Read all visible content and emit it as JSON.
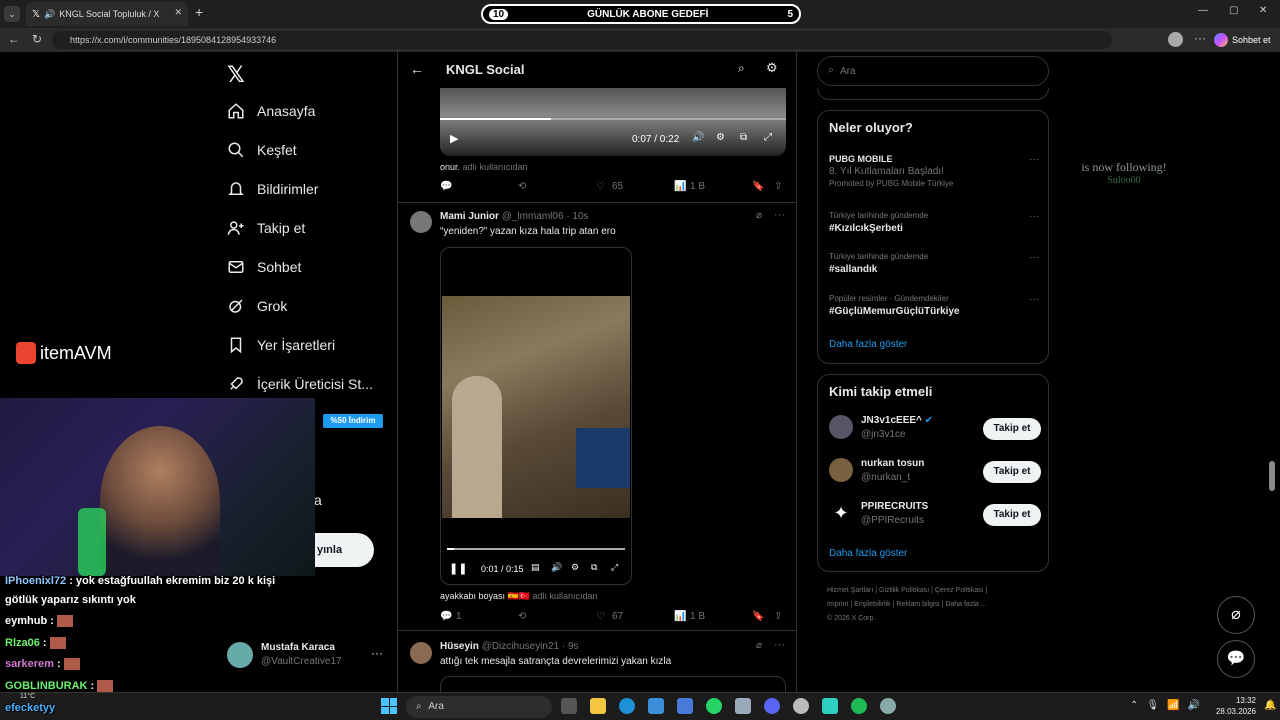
{
  "browser": {
    "tab_title": "KNGL Social Topluluk / X",
    "url": "https://x.com/i/communities/1895084128954933746",
    "chat_label": "Sohbet et"
  },
  "sub_goal": {
    "left": "10",
    "title": "GÜNLÜK ABONE GEDEFİ",
    "right": "5"
  },
  "nav": {
    "items": [
      "Anasayfa",
      "Keşfet",
      "Bildirimler",
      "Takip et",
      "Sohbet",
      "Grok",
      "Yer İşaretleri",
      "İçerik Üreticisi St..."
    ],
    "post_label": "yınla",
    "partial_letter": "a",
    "user_name": "Mustafa Karaca",
    "user_handle": "@VaultCreative17"
  },
  "community": {
    "title": "KNGL Social"
  },
  "tweets": [
    {
      "video_time": "0:07 / 0:22",
      "credit_name": "onur.",
      "credit_suffix": "adlı kullanıcıdan",
      "likes": "65",
      "views": "1 B"
    },
    {
      "name": "Mami Junior",
      "handle": "@_lmmaml06",
      "time": "· 10s",
      "text": "“yeniden?” yazan kıza hala trip atan ero",
      "video_time": "0:01 / 0:15",
      "credit_name": "ayakkabı boyası",
      "credit_suffix": "adlı kullanıcıdan",
      "replies": "1",
      "likes": "67",
      "views": "1 B"
    },
    {
      "name": "Hüseyin",
      "handle": "@Dizcihuseyin21",
      "time": "· 9s",
      "text": "attığı tek mesajla satrançta devrelerimizi yakan kızla"
    }
  ],
  "search": {
    "placeholder": "Ara"
  },
  "trends": {
    "title": "Neler oluyor?",
    "items": [
      {
        "context": "PUBG MOBILE",
        "name": "8. Yıl Kutlamaları Başladı!",
        "extra": "Promoted by PUBG Mobile Türkiye"
      },
      {
        "context": "Türkiye tarihinde gündemde",
        "name": "#KızılcıkŞerbeti"
      },
      {
        "context": "Türkiye tarihinde gündemde",
        "name": "#sallandık"
      },
      {
        "context": "Popüler resimler · Gündemdekiler",
        "name": "#GüçlüMemurGüçlüTürkiye"
      }
    ],
    "show_more": "Daha fazla göster"
  },
  "who_to_follow": {
    "title": "Kimi takip etmeli",
    "users": [
      {
        "name": "JN3v1cEEE^",
        "handle": "@jn3v1ce",
        "button": "Takip et"
      },
      {
        "name": "nurkan tosun",
        "handle": "@nurkan_t",
        "button": "Takip et"
      },
      {
        "name": "PPIRECRUITS",
        "handle": "@PPIRecruits",
        "button": "Takip et"
      }
    ],
    "show_more": "Daha fazla göster"
  },
  "footer": {
    "links": [
      "Hizmet Şartları",
      "Gizlilik Politikası",
      "Çerez Politikası",
      "Imprint",
      "Erişilebilirlik",
      "Reklam bilgisi",
      "Daha fazla ..."
    ],
    "copyright": "© 2026 X Corp."
  },
  "overlay": {
    "brand": "itemAVM",
    "discount": "%50 İndirim",
    "follow_alert_text": "is now following!",
    "follow_alert_user": "Suloo00",
    "chat": [
      {
        "user": "IPhoenixl72",
        "msg": " : yok estağfuullah ekremim biz 20 k kişi"
      },
      {
        "user": "",
        "msg": "götlük yaparız sıkıntı yok"
      },
      {
        "user": "eymhub",
        "msg": " :"
      },
      {
        "user": "Rlza06",
        "msg": " :"
      },
      {
        "user": "sarkerem",
        "msg": " :"
      },
      {
        "user": "GOBLINBURAK",
        "msg": " :"
      },
      {
        "user": "efecketyy",
        "msg": ""
      }
    ]
  },
  "taskbar": {
    "search_placeholder": "Ara",
    "time": "13:32",
    "date": "28.03.2026",
    "weather": "11°C"
  }
}
